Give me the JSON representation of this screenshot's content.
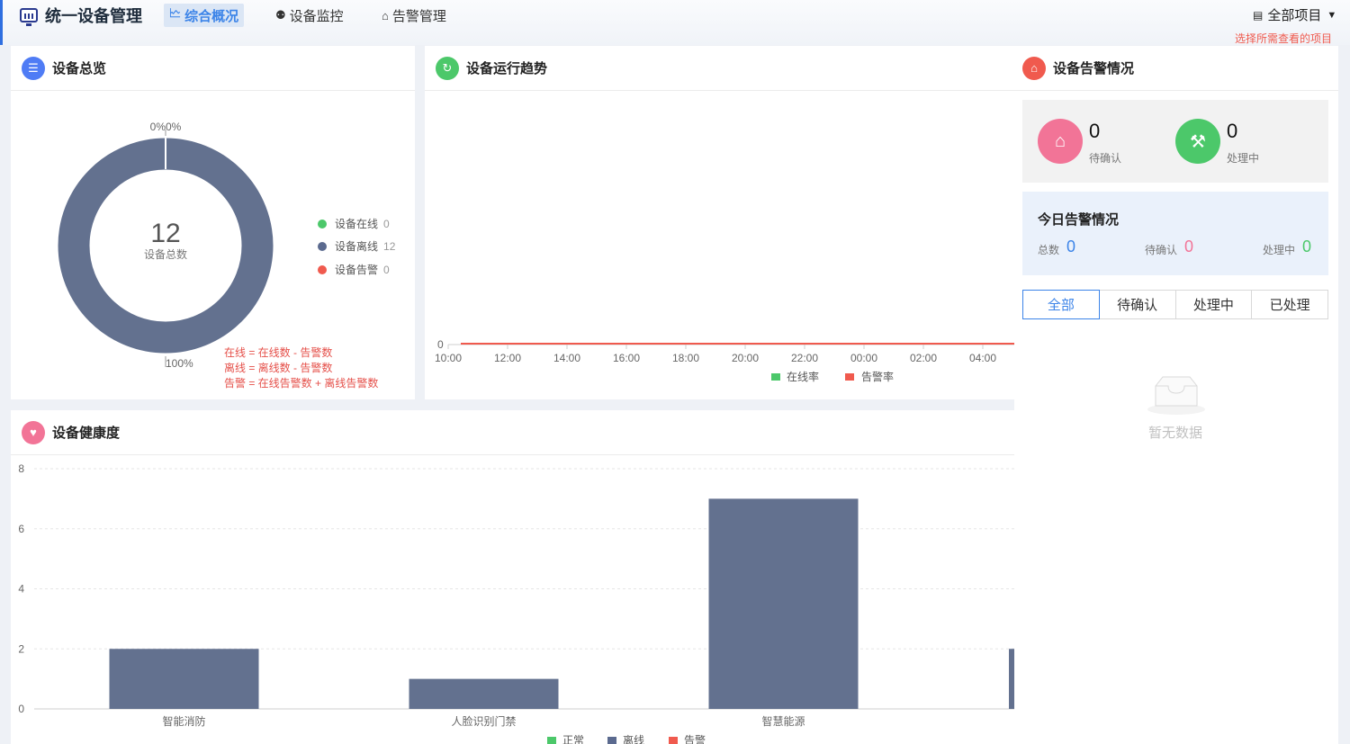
{
  "header": {
    "app_title": "统一设备管理",
    "nav": [
      {
        "label": "综合概况",
        "icon": "line-chart-icon",
        "active": true
      },
      {
        "label": "设备监控",
        "icon": "location-pin-icon",
        "active": false
      },
      {
        "label": "告警管理",
        "icon": "alarm-house-icon",
        "active": false
      }
    ],
    "project_selector": "全部项目",
    "project_hint": "选择所需查看的项目"
  },
  "overview": {
    "title": "设备总览",
    "total_value": "12",
    "total_label": "设备总数",
    "top_label": "0%0%",
    "bottom_label": "100%",
    "legend": [
      {
        "label": "设备在线",
        "count": "0",
        "color": "#4cc86a"
      },
      {
        "label": "设备离线",
        "count": "12",
        "color": "#5b6a8f"
      },
      {
        "label": "设备告警",
        "count": "0",
        "color": "#f05a4e"
      }
    ],
    "formulas": [
      "在线 = 在线数 - 告警数",
      "离线 = 离线数 - 告警数",
      "告警 = 在线告警数 + 离线告警数"
    ],
    "ring_color": "#63718f",
    "ring_share": [
      0,
      1,
      0
    ]
  },
  "trend": {
    "title": "设备运行趋势",
    "y_label": "0",
    "x_labels": [
      "10:00",
      "12:00",
      "14:00",
      "16:00",
      "18:00",
      "20:00",
      "22:00",
      "00:00",
      "02:00",
      "04:00"
    ],
    "legend": [
      {
        "label": "在线率",
        "color": "#4cc86a"
      },
      {
        "label": "告警率",
        "color": "#f05a4e"
      }
    ]
  },
  "alarm": {
    "title": "设备告警情况",
    "pending_count": "0",
    "pending_label": "待确认",
    "processing_count": "0",
    "processing_label": "处理中",
    "today_title": "今日告警情况",
    "today_total_label": "总数",
    "today_total": "0",
    "today_pending_label": "待确认",
    "today_pending": "0",
    "today_processing_label": "处理中",
    "today_processing": "0",
    "tabs": [
      "全部",
      "待确认",
      "处理中",
      "已处理"
    ],
    "empty_text": "暂无数据"
  },
  "health": {
    "title": "设备健康度",
    "legend": [
      {
        "label": "正常",
        "color": "#4cc86a"
      },
      {
        "label": "离线",
        "color": "#5b6a8f"
      },
      {
        "label": "告警",
        "color": "#f05a4e"
      }
    ]
  },
  "chart_data": {
    "type": "bar",
    "categories": [
      "智能消防",
      "人脸识别门禁",
      "智慧能源"
    ],
    "series": [
      {
        "name": "离线",
        "values": [
          2,
          1,
          7
        ]
      }
    ],
    "ylim": [
      0,
      8
    ],
    "y_ticks": [
      0,
      2,
      4,
      6,
      8
    ],
    "bar_color": "#63718f",
    "grid": true
  }
}
